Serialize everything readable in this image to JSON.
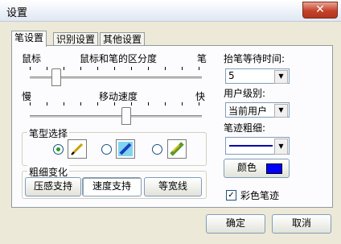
{
  "window": {
    "title": "设置",
    "close_glyph": "✕"
  },
  "tabs": [
    "笔设置",
    "识别设置",
    "其他设置"
  ],
  "slider1": {
    "left_label": "鼠标",
    "center_label": "鼠标和笔的区分度",
    "right_label": "笔"
  },
  "slider2": {
    "left_label": "慢",
    "center_label": "移动速度",
    "right_label": "快"
  },
  "pen_type": {
    "title": "笔型选择"
  },
  "thickness_change": {
    "title": "粗细变化",
    "buttons": [
      "压感支持",
      "速度支持",
      "等宽线"
    ]
  },
  "right": {
    "wait_label": "抬笔等待时间:",
    "wait_value": "5",
    "user_level_label": "用户级别:",
    "user_level_value": "当前用户",
    "stroke_label": "笔迹粗细:",
    "color_label": "颜色",
    "color_value": "#0000ff",
    "color_stroke_label": "彩色笔迹",
    "color_stroke_checked": "✓"
  },
  "footer": {
    "ok": "确定",
    "cancel": "取消"
  }
}
